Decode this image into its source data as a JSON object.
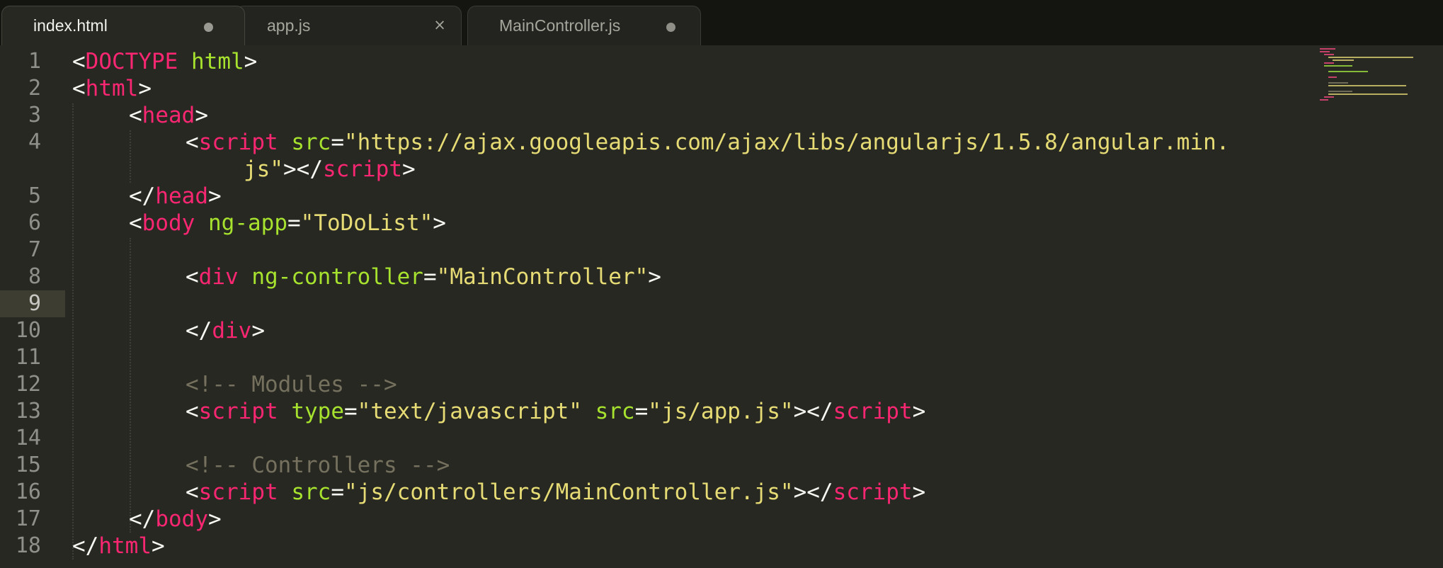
{
  "tabs": [
    {
      "label": "index.html",
      "indicator": "modified-dot-icon",
      "active": true
    },
    {
      "label": "app.js",
      "indicator": "close-icon",
      "active": false
    },
    {
      "label": "MainController.js",
      "indicator": "modified-dot-icon",
      "active": false
    }
  ],
  "icons": {
    "close": "×"
  },
  "colors": {
    "background": "#272822",
    "tag": "#f92672",
    "attribute": "#a6e22e",
    "string": "#e6db74",
    "comment": "#75715e",
    "text": "#f8f8f2"
  },
  "current_line": "9",
  "line_numbers": [
    "1",
    "2",
    "3",
    "4",
    "5",
    "6",
    "7",
    "8",
    "9",
    "10",
    "11",
    "12",
    "13",
    "14",
    "15",
    "16",
    "17",
    "18"
  ],
  "code": {
    "l1": {
      "p1": "<",
      "tag": "DOCTYPE",
      "sp": " ",
      "attr": "html",
      "p2": ">"
    },
    "l2": {
      "p1": "<",
      "tag": "html",
      "p2": ">"
    },
    "l3": {
      "p1": "<",
      "tag": "head",
      "p2": ">"
    },
    "l4a": {
      "p1": "<",
      "tag": "script",
      "sp": " ",
      "attr": "src",
      "eq": "=",
      "str": "\"https://ajax.googleapis.com/ajax/libs/angularjs/1.5.8/angular.min."
    },
    "l4b": {
      "str": "js\"",
      "p1": "></",
      "tag": "script",
      "p2": ">"
    },
    "l5": {
      "p1": "</",
      "tag": "head",
      "p2": ">"
    },
    "l6": {
      "p1": "<",
      "tag": "body",
      "sp": " ",
      "attr": "ng-app",
      "eq": "=",
      "str": "\"ToDoList\"",
      "p2": ">"
    },
    "l8": {
      "p1": "<",
      "tag": "div",
      "sp": " ",
      "attr": "ng-controller",
      "eq": "=",
      "str": "\"MainController\"",
      "p2": ">"
    },
    "l10": {
      "p1": "</",
      "tag": "div",
      "p2": ">"
    },
    "l12": {
      "comment": "<!-- Modules -->"
    },
    "l13": {
      "p1": "<",
      "tag": "script",
      "sp": " ",
      "attr": "type",
      "eq": "=",
      "str": "\"text/javascript\"",
      "sp2": " ",
      "attr2": "src",
      "eq2": "=",
      "str2": "\"js/app.js\"",
      "p2": "></",
      "tag2": "script",
      "p3": ">"
    },
    "l15": {
      "comment": "<!-- Controllers -->"
    },
    "l16": {
      "p1": "<",
      "tag": "script",
      "sp": " ",
      "attr": "src",
      "eq": "=",
      "str": "\"js/controllers/MainController.js\"",
      "p2": "></",
      "tag2": "script",
      "p3": ">"
    },
    "l17": {
      "p1": "</",
      "tag": "body",
      "p2": ">"
    },
    "l18": {
      "p1": "</",
      "tag": "html",
      "p2": ">"
    }
  }
}
